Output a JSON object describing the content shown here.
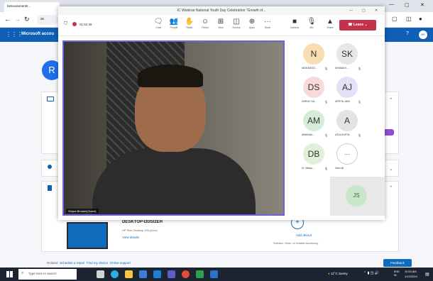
{
  "browser": {
    "tab_active": "betsoulumenbr...",
    "address": "ac"
  },
  "ms_account": {
    "title": "Microsoft accou",
    "avatar": "R",
    "help": "?",
    "user_initials": "MF"
  },
  "device": {
    "name": "DESKTOP-DDSI2EH",
    "model": "HP Slim Desktop 290-p0xxx",
    "view_details": "View details",
    "add_device": "Add device",
    "add_device_hint": "Surface, Xbox, or related accessory"
  },
  "footer_links": [
    "Related",
    "Schedule a repair",
    "Find my device",
    "Online support"
  ],
  "feedback": "Feedback",
  "teams": {
    "title": "IC Webinar National Youth Day Celebration \"Growth of...",
    "timer": "01:52:49",
    "controls": [
      {
        "label": "Chat",
        "icon": "chat-icon",
        "glyph": "🗨"
      },
      {
        "label": "People",
        "icon": "people-icon",
        "glyph": "👥",
        "badge": "47"
      },
      {
        "label": "Raise",
        "icon": "raise-hand-icon",
        "glyph": "✋"
      },
      {
        "label": "React",
        "icon": "react-icon",
        "glyph": "☺"
      },
      {
        "label": "View",
        "icon": "view-icon",
        "glyph": "⊞"
      },
      {
        "label": "Rooms",
        "icon": "rooms-icon",
        "glyph": "◫"
      },
      {
        "label": "Apps",
        "icon": "apps-icon",
        "glyph": "⊕"
      },
      {
        "label": "More",
        "icon": "more-icon",
        "glyph": "···"
      },
      {
        "label": "Camera",
        "icon": "camera-icon",
        "glyph": "■"
      },
      {
        "label": "Mic",
        "icon": "mic-icon",
        "glyph": "🎙"
      },
      {
        "label": "Share",
        "icon": "share-icon",
        "glyph": "▲"
      }
    ],
    "leave": "Leave",
    "speaker_name": "Shipra Bhutani(Guest)",
    "participants": [
      {
        "initials": "N",
        "name": "NISHANTDI...",
        "color": "#f8ddb0"
      },
      {
        "initials": "SK",
        "name": "SHIVAM K...",
        "color": "#e7e7e7"
      },
      {
        "initials": "DS",
        "name": "DHRUV SA...",
        "color": "#f9d9d9"
      },
      {
        "initials": "AJ",
        "name": "ARPITA JAIN",
        "color": "#e4e1f7"
      },
      {
        "initials": "AM",
        "name": "ABHINAV...",
        "color": "#d6ecd8"
      },
      {
        "initials": "A",
        "name": "ATULGUPTA",
        "color": "#e3e3e3"
      },
      {
        "initials": "DB",
        "name": "Dr. Manju...",
        "color": "#e2f0d9"
      },
      {
        "initials": "···",
        "name": "View all",
        "color": "#ffffff"
      }
    ],
    "self_initials": "JS"
  },
  "taskbar": {
    "search": "Type here to search",
    "weather": "11°C  Sunny",
    "lang": "ENG IN",
    "time": "11:53 AM",
    "date": "1/12/2024"
  }
}
